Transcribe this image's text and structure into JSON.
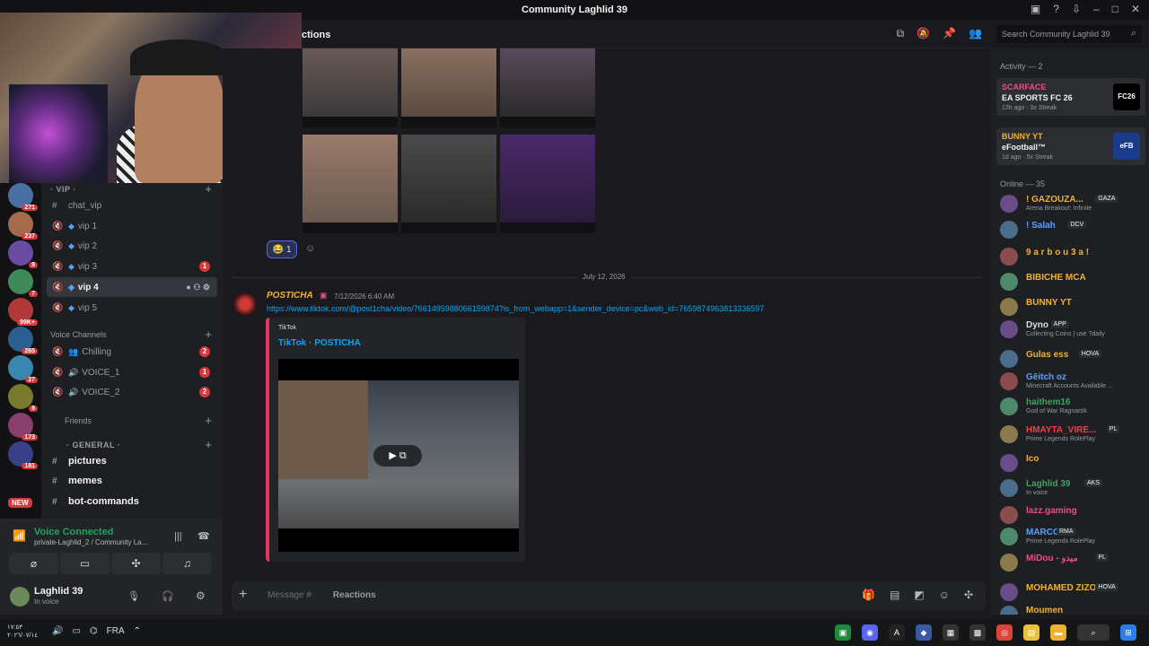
{
  "window": {
    "title": "Community Laghlid 39"
  },
  "guild_badges": [
    "271",
    "237",
    "8",
    "7",
    "99K+",
    "265",
    "27",
    "8",
    "173",
    "181"
  ],
  "guild_new": "NEW",
  "channels": {
    "vip_category": "· VIP ·",
    "vip_items": [
      {
        "name": "chat_vip",
        "badge": ""
      },
      {
        "name": "vip 1",
        "badge": ""
      },
      {
        "name": "vip 2",
        "badge": ""
      },
      {
        "name": "vip 3",
        "badge": "1"
      },
      {
        "name": "vip 4",
        "badge": ""
      },
      {
        "name": "vip 5",
        "badge": ""
      }
    ],
    "voice_category": "Voice Channels",
    "voice_items": [
      {
        "name": "Chilling",
        "badge": "2"
      },
      {
        "name": "VOICE_1",
        "badge": "1"
      },
      {
        "name": "VOICE_2",
        "badge": "2"
      }
    ],
    "friends_category": "Friends",
    "general_category": "· GENERAL ·",
    "general_items": [
      "pictures",
      "memes",
      "bot-commands"
    ]
  },
  "voice": {
    "title": "Voice Connected",
    "subtitle": "private-Laghlid_2 / Community La..."
  },
  "user": {
    "name": "Laghlid 39",
    "status": "In voice"
  },
  "header": {
    "channel_name": "ctions",
    "search_placeholder": "Search Community Laghlid 39"
  },
  "messages": {
    "reaction_count": "1",
    "date_divider": "July 12, 2026",
    "author": "POSTICHA",
    "timestamp": "7/12/2026 6:40 AM",
    "link": "https://www.tiktok.com/@post1cha/video/7661495988066159874?is_from_webapp=1&sender_device=pc&web_id=7659874963813336597",
    "embed_provider": "TikTok",
    "embed_title": "TikTok · POSTICHA"
  },
  "composer": {
    "placeholder": "Message #",
    "channel": "Reactions"
  },
  "members": {
    "activity_header": "Activity — 2",
    "activities": [
      {
        "name": "SCARFACE",
        "game": "EA SPORTS FC 26",
        "meta": "12h ago · 3x Streak",
        "logo": "FC26",
        "color": "#e84d8a"
      },
      {
        "name": "BUNNY YT",
        "game": "eFootball™",
        "meta": "1d ago · 5x Streak",
        "logo": "eFB",
        "color": "#f0b132"
      }
    ],
    "online_header": "Online — 35",
    "list": [
      {
        "name": "! GAZOUZA...",
        "tag": "GAZA",
        "status": "Arena Breakout: Infinite",
        "color": "#f0b132"
      },
      {
        "name": "! Salah",
        "tag": "DCV",
        "status": "",
        "color": "#5aa0ff"
      },
      {
        "name": "9 a r b o u 3 a !",
        "tag": "",
        "status": "",
        "color": "#f0b132"
      },
      {
        "name": "BIBICHE MCA",
        "tag": "",
        "status": "",
        "color": "#f0b132"
      },
      {
        "name": "BUNNY YT",
        "tag": "",
        "status": "",
        "color": "#f0b132"
      },
      {
        "name": "Dyno",
        "tag": "APP",
        "status": "Collecting Coins | use ?daily",
        "color": "#dbdee1"
      },
      {
        "name": "Gulas ess",
        "tag": "HOVA",
        "status": "",
        "color": "#f0b132"
      },
      {
        "name": "Gēitch oz",
        "tag": "",
        "status": "Minecraft Accounts Available ...",
        "color": "#5aa0ff"
      },
      {
        "name": "haithem16",
        "tag": "",
        "status": "God of War Ragnarök",
        "color": "#3ba55c"
      },
      {
        "name": "HMAYTA_VIRE...",
        "tag": "PL",
        "status": "Prime Legends RolePlay",
        "color": "#f23f42"
      },
      {
        "name": "Ico",
        "tag": "",
        "status": "",
        "color": "#f0b132"
      },
      {
        "name": "Laghlid 39",
        "tag": "AKS",
        "status": "In voice",
        "color": "#3ba55c"
      },
      {
        "name": "lazz.gaming",
        "tag": "",
        "status": "",
        "color": "#e84d8a"
      },
      {
        "name": "MARCO",
        "tag": "RMA",
        "status": "Prime Legends RolePlay",
        "color": "#5aa0ff"
      },
      {
        "name": "MiDou - ميدو",
        "tag": "PL",
        "status": "",
        "color": "#e84d8a"
      },
      {
        "name": "MOHAMED ZIZO",
        "tag": "HOVA",
        "status": "",
        "color": "#f0b132"
      },
      {
        "name": "Moumen",
        "tag": "",
        "status": "",
        "color": "#f0b132"
      }
    ]
  },
  "taskbar": {
    "time": "١٧:٥٣",
    "date": "٢٠٢٦/٠٧/١٤",
    "lang": "FRA"
  }
}
